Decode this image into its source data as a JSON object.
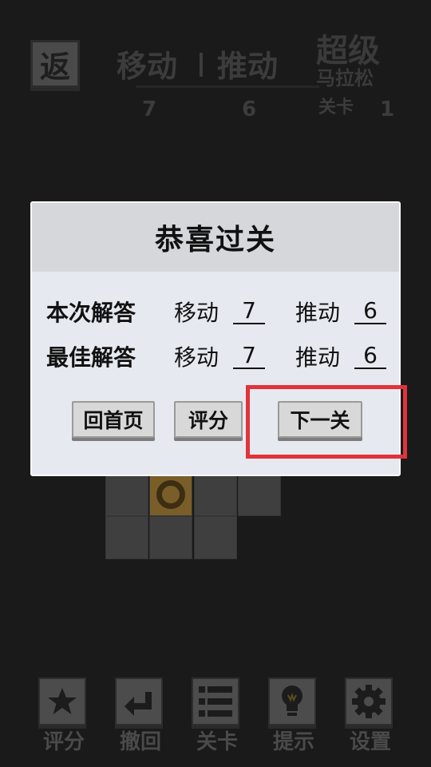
{
  "hud": {
    "back_label": "返",
    "moves_label": "移动",
    "pushes_label": "推动",
    "moves_value": "7",
    "pushes_value": "6",
    "game_title_line1": "超级",
    "game_title_line2": "马拉松",
    "level_label": "关卡",
    "level_value": "1"
  },
  "dialog": {
    "title": "恭喜过关",
    "current": {
      "row_title": "本次解答",
      "moves_label": "移动",
      "moves_value": "7",
      "pushes_label": "推动",
      "pushes_value": "6"
    },
    "best": {
      "row_title": "最佳解答",
      "moves_label": "移动",
      "moves_value": "7",
      "pushes_label": "推动",
      "pushes_value": "6"
    },
    "buttons": {
      "home": "回首页",
      "rate": "评分",
      "next": "下一关"
    }
  },
  "toolbar": {
    "items": [
      {
        "label": "评分",
        "icon": "star-icon"
      },
      {
        "label": "撤回",
        "icon": "undo-icon"
      },
      {
        "label": "关卡",
        "icon": "level-list-icon"
      },
      {
        "label": "提示",
        "icon": "lightbulb-icon"
      },
      {
        "label": "设置",
        "icon": "gear-icon"
      }
    ]
  },
  "colors": {
    "background": "#1a1a1a",
    "dialog_bg": "#e6e9ef",
    "dialog_header": "#d5d7da",
    "highlight": "#e0333b",
    "goal_tile": "#7a5e2a"
  }
}
